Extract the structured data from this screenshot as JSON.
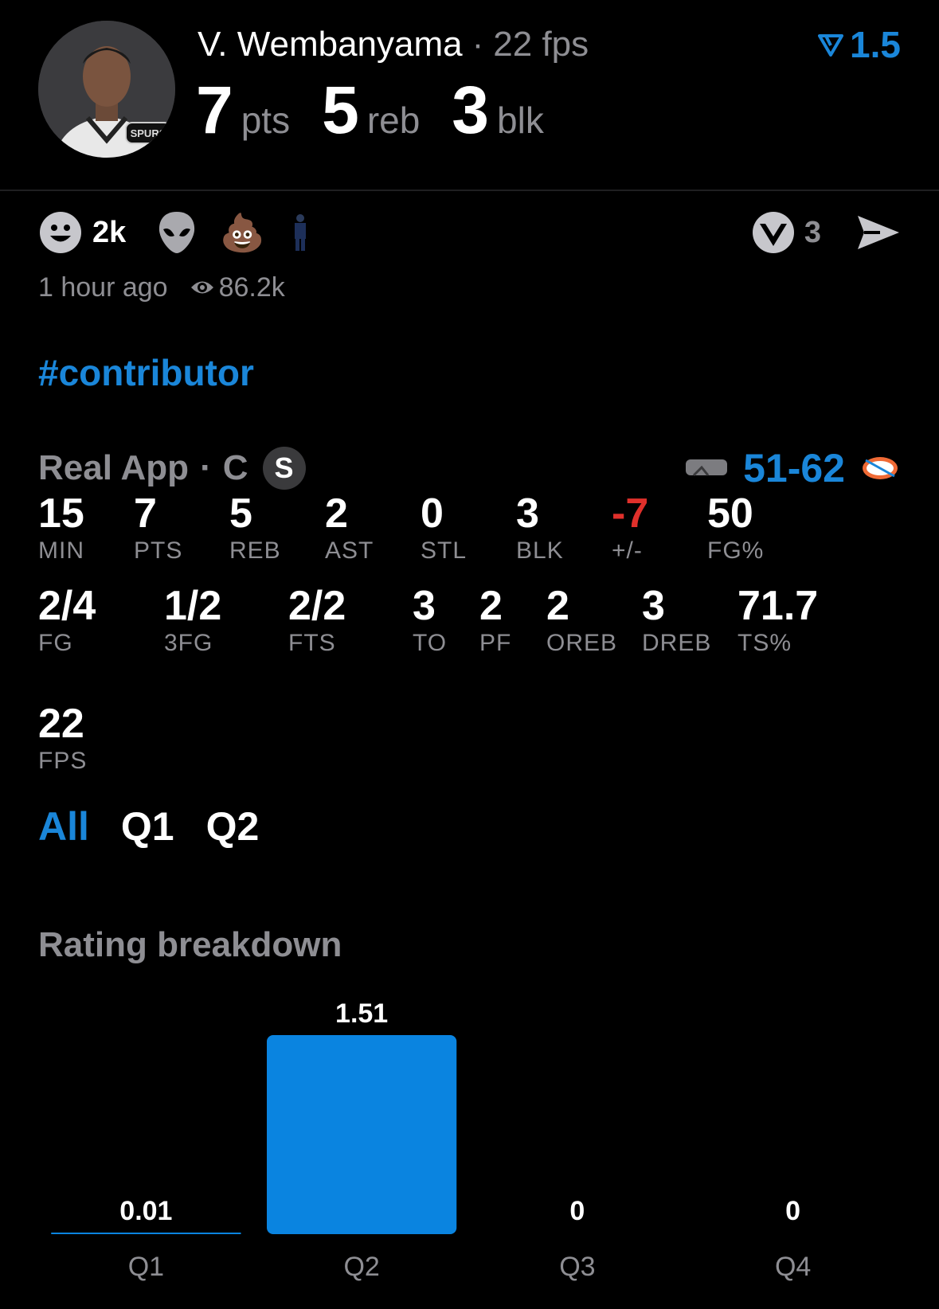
{
  "header": {
    "player_name": "V. Wembanyama",
    "separator": "·",
    "fps_text": "22 fps",
    "rating": "1.5",
    "headline": [
      {
        "value": "7",
        "unit": "pts"
      },
      {
        "value": "5",
        "unit": "reb"
      },
      {
        "value": "3",
        "unit": "blk"
      }
    ],
    "avatar_team_text": "SPURS"
  },
  "reactions": {
    "smile_count": "2k",
    "icons": [
      "smile-icon",
      "alien-icon",
      "poop-emoji",
      "player-sticker"
    ],
    "poop_glyph": "💩",
    "share_count": "3"
  },
  "meta": {
    "time_ago": "1 hour ago",
    "views": "86.2k"
  },
  "hashtag": "#contributor",
  "source": {
    "app": "Real App",
    "separator": "·",
    "position": "C",
    "badge": "S",
    "score": "51-62"
  },
  "stats_row1": [
    {
      "value": "15",
      "label": "MIN"
    },
    {
      "value": "7",
      "label": "PTS"
    },
    {
      "value": "5",
      "label": "REB"
    },
    {
      "value": "2",
      "label": "AST"
    },
    {
      "value": "0",
      "label": "STL"
    },
    {
      "value": "3",
      "label": "BLK"
    },
    {
      "value": "-7",
      "label": "+/-"
    },
    {
      "value": "50",
      "label": "FG%"
    }
  ],
  "stats_row2": [
    {
      "value": "2/4",
      "label": "FG"
    },
    {
      "value": "1/2",
      "label": "3FG"
    },
    {
      "value": "2/2",
      "label": "FTS"
    },
    {
      "value": "3",
      "label": "TO"
    },
    {
      "value": "2",
      "label": "PF"
    },
    {
      "value": "2",
      "label": "OREB"
    },
    {
      "value": "3",
      "label": "DREB"
    },
    {
      "value": "71.7",
      "label": "TS%"
    }
  ],
  "stats_row3": [
    {
      "value": "22",
      "label": "FPS"
    }
  ],
  "tabs": [
    "All",
    "Q1",
    "Q2"
  ],
  "rating_breakdown": {
    "title": "Rating breakdown"
  },
  "chart_data": {
    "type": "bar",
    "categories": [
      "Q1",
      "Q2",
      "Q3",
      "Q4"
    ],
    "values": [
      0.01,
      1.51,
      0,
      0
    ],
    "value_labels": [
      "0.01",
      "1.51",
      "0",
      "0"
    ],
    "ylim": [
      0,
      1.51
    ],
    "grid": false,
    "bar_color": "#0a84e0"
  },
  "colors": {
    "accent": "#1a86d9",
    "negative": "#e0302b",
    "muted": "#8e8e93"
  }
}
